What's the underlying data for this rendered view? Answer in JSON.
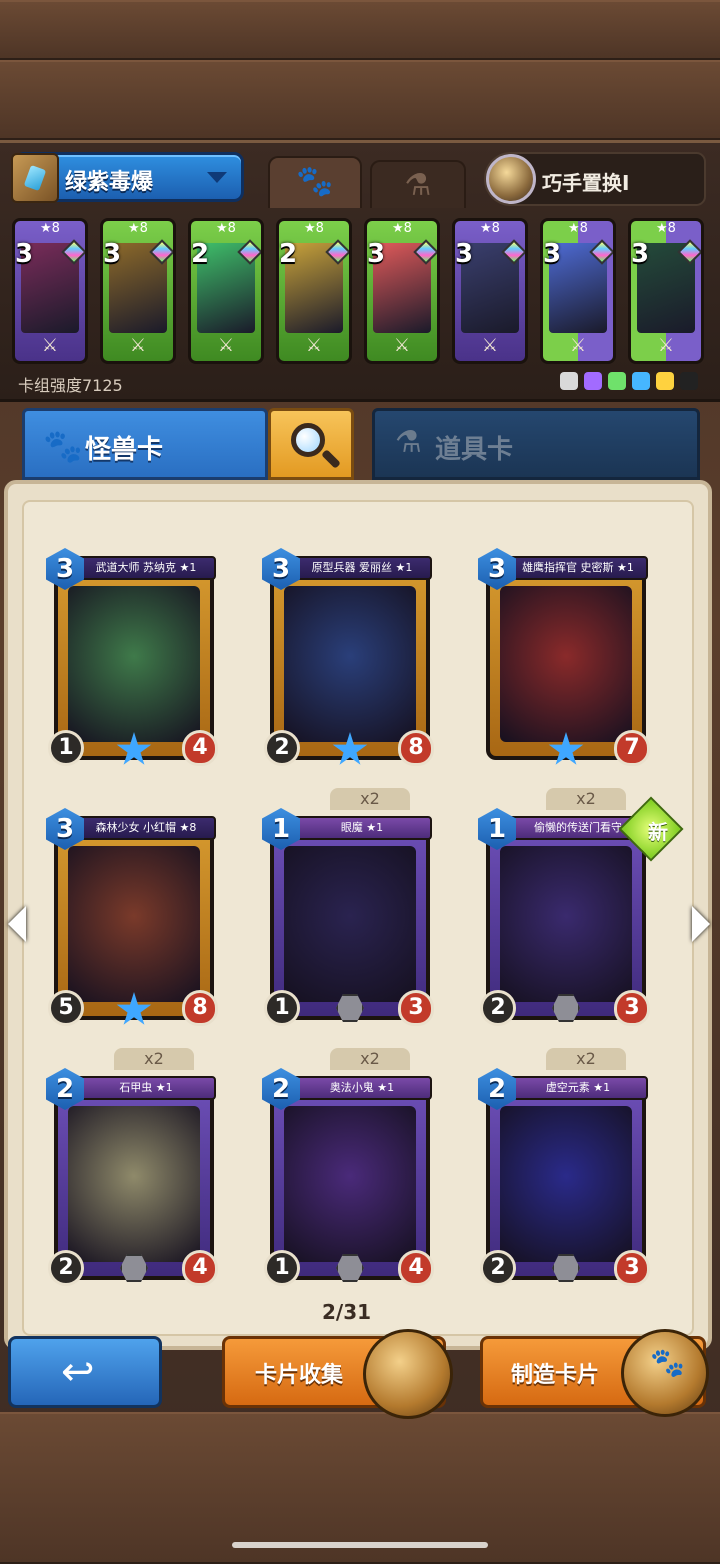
{
  "deck": {
    "name": "绿紫毒爆",
    "skill": "巧手置换I",
    "strength_label": "卡组强度7125",
    "element_colors": [
      "#d9d9d9",
      "#a26bff",
      "#6fe16b",
      "#46b6ff",
      "#ffd23f",
      "#222222"
    ],
    "cards": [
      {
        "level": "★8",
        "cost": "3",
        "color": "purple",
        "art": "#7a2c5a"
      },
      {
        "level": "★8",
        "cost": "3",
        "color": "green",
        "art": "#8d6a2a"
      },
      {
        "level": "★8",
        "cost": "2",
        "color": "green",
        "art": "#3fbf6a"
      },
      {
        "level": "★8",
        "cost": "2",
        "color": "green",
        "art": "#c8a23a"
      },
      {
        "level": "★8",
        "cost": "3",
        "color": "green",
        "art": "#e05a5a"
      },
      {
        "level": "★8",
        "cost": "3",
        "color": "purple",
        "art": "#3a3f6e"
      },
      {
        "level": "★8",
        "cost": "3",
        "color": "mix",
        "art": "#4e6bd4"
      },
      {
        "level": "★8",
        "cost": "3",
        "color": "mix",
        "art": "#244b3a"
      }
    ]
  },
  "tabs": {
    "monster": "怪兽卡",
    "item": "道具卡"
  },
  "collection": [
    {
      "name": "武道大师 苏纳克 ★1",
      "cost": "3",
      "atk": "1",
      "hp": "4",
      "style": "gold",
      "badge": "star",
      "dup": "",
      "art": "#3f7a4a"
    },
    {
      "name": "原型兵器 爱丽丝 ★1",
      "cost": "3",
      "atk": "2",
      "hp": "8",
      "style": "gold",
      "badge": "star",
      "dup": "",
      "art": "#2a3f7a"
    },
    {
      "name": "雄鹰指挥官 史密斯 ★1",
      "cost": "3",
      "atk": "",
      "hp": "7",
      "style": "gold",
      "badge": "star",
      "dup": "",
      "art": "#8a2a2a"
    },
    {
      "name": "森林少女 小红帽 ★8",
      "cost": "3",
      "atk": "5",
      "hp": "8",
      "style": "gold",
      "badge": "star",
      "dup": "",
      "art": "#7a3a2a"
    },
    {
      "name": "眼魔 ★1",
      "cost": "1",
      "atk": "1",
      "hp": "3",
      "style": "violet",
      "badge": "hex",
      "dup": "x2",
      "art": "#2a2350"
    },
    {
      "name": "偷懒的传送门看守",
      "cost": "1",
      "atk": "2",
      "hp": "3",
      "style": "violet",
      "badge": "hex",
      "dup": "x2",
      "art": "#3a2a6e",
      "is_new": true
    },
    {
      "name": "石甲虫 ★1",
      "cost": "2",
      "atk": "2",
      "hp": "4",
      "style": "violet",
      "badge": "hex",
      "dup": "x2",
      "art": "#8f8a6a"
    },
    {
      "name": "奥法小鬼 ★1",
      "cost": "2",
      "atk": "1",
      "hp": "4",
      "style": "violet",
      "badge": "hex",
      "dup": "x2",
      "art": "#4a2a7a"
    },
    {
      "name": "虚空元素 ★1",
      "cost": "2",
      "atk": "2",
      "hp": "3",
      "style": "violet",
      "badge": "hex",
      "dup": "x2",
      "art": "#2a2a8a"
    }
  ],
  "new_label": "新",
  "page": "2/31",
  "buttons": {
    "back": "↩",
    "collect": "卡片收集",
    "craft": "制造卡片"
  }
}
